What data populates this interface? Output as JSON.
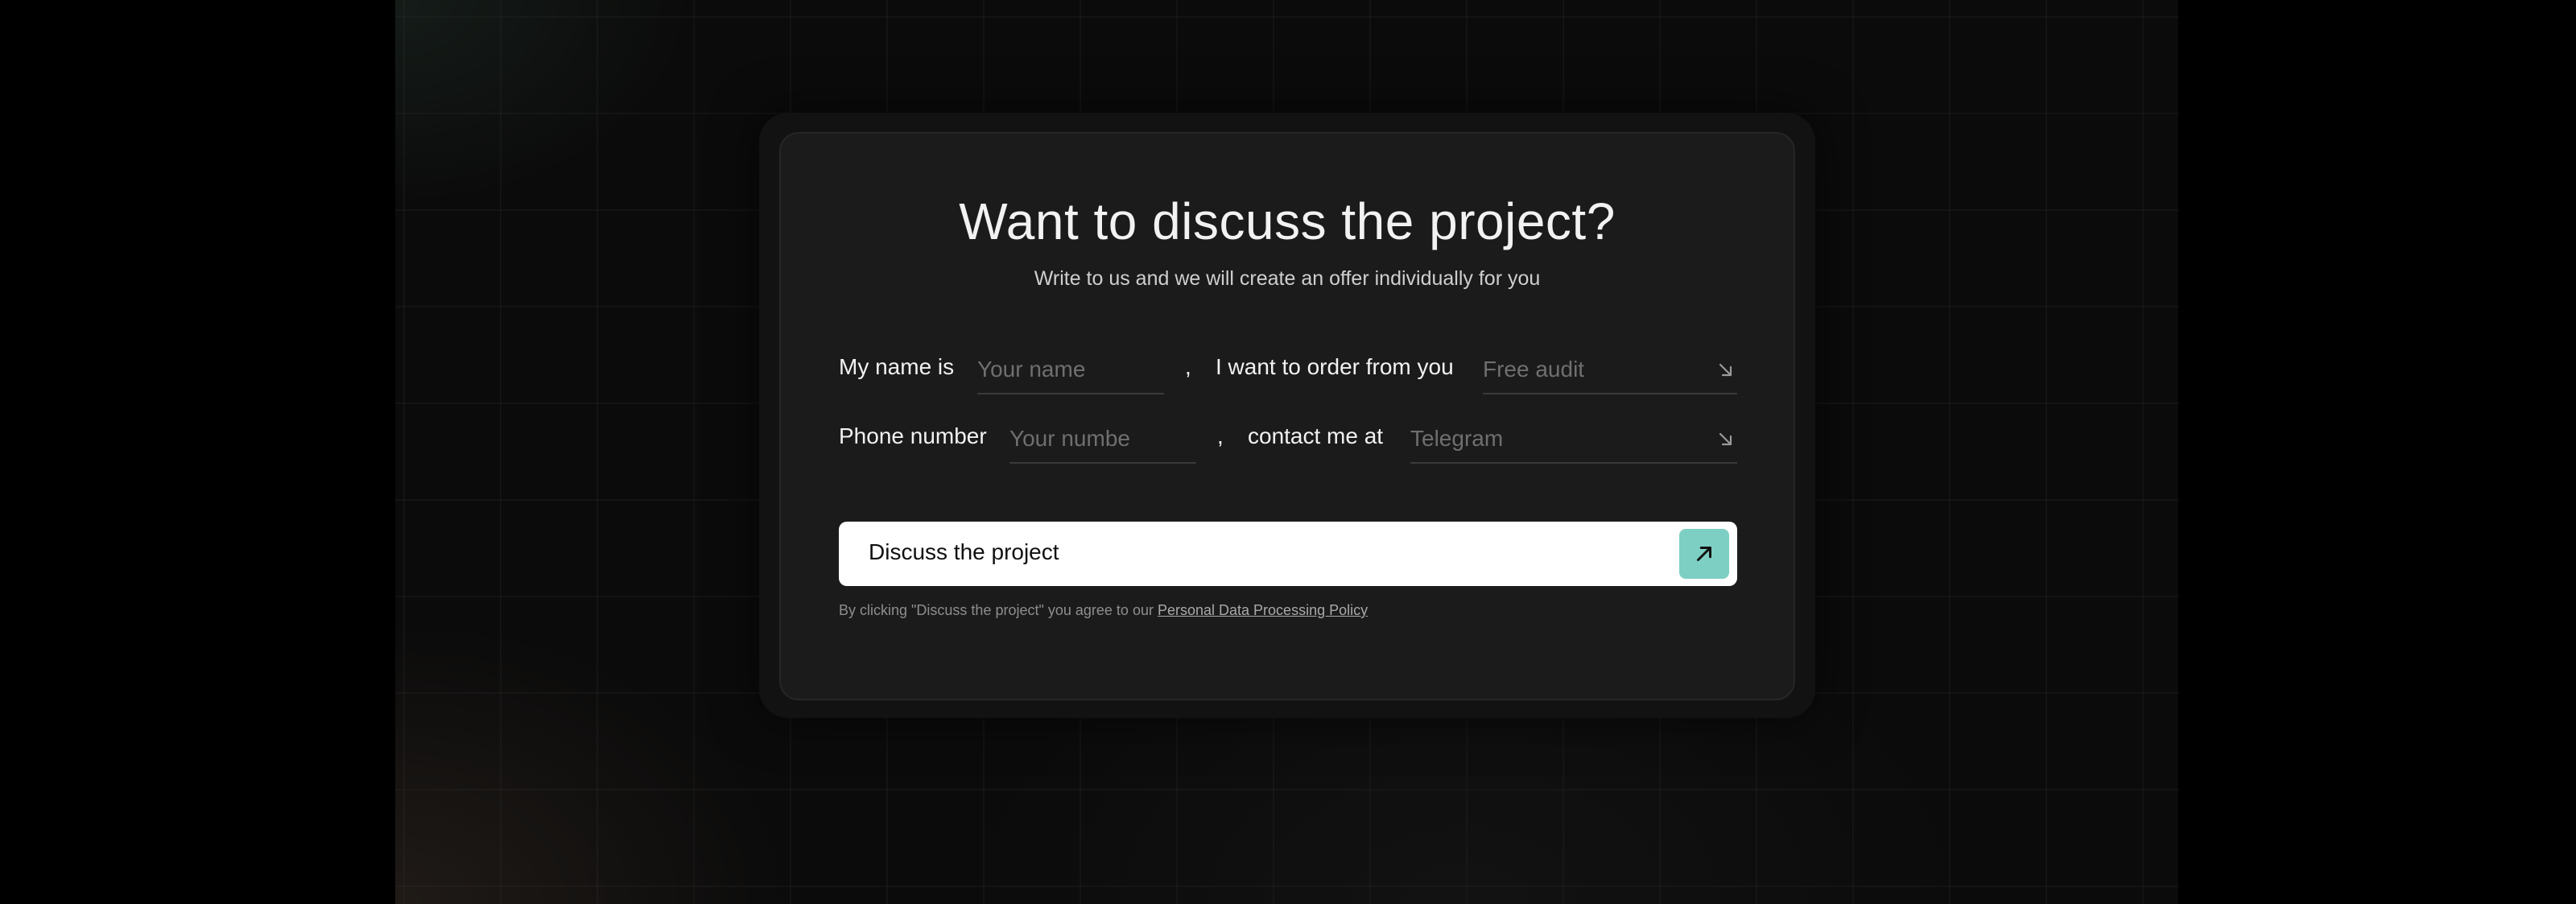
{
  "title": "Want to discuss the project?",
  "subtitle": "Write to us and we will create an offer individually for you",
  "row1": {
    "name_label": "My name is",
    "name_placeholder": "Your name",
    "comma": ",",
    "service_label": "I want to order from you",
    "service_value": "Free audit",
    "service_icon": "arrow-down-right-icon"
  },
  "row2": {
    "phone_label": "Phone number",
    "phone_placeholder": "Your numbe",
    "comma": ",",
    "contact_label": "contact me at",
    "contact_value": "Telegram",
    "contact_icon": "arrow-down-right-icon"
  },
  "submit": {
    "label": "Discuss the project",
    "icon": "arrow-up-right-icon"
  },
  "consent": {
    "text": "By clicking \"Discuss the project\" you agree to our",
    "link": "Personal Data Processing Policy"
  },
  "colors": {
    "accent": "#7ecfc3",
    "card_bg": "#1b1b1b",
    "page_bg": "#000000"
  }
}
